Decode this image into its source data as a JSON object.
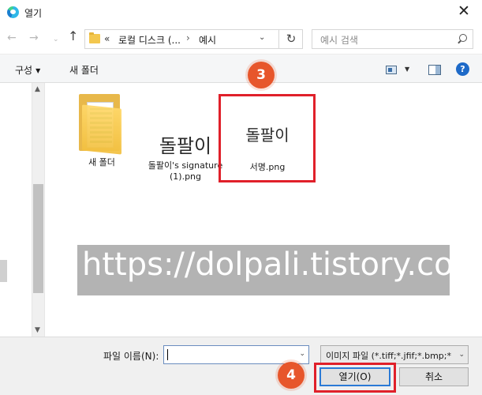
{
  "window": {
    "title": "열기",
    "close_glyph": "✕"
  },
  "nav": {
    "back": "←",
    "forward": "→",
    "recent": "⌄",
    "up": "↑",
    "breadcrumb": {
      "overflow": "«",
      "drive": "로컬 디스크 (...",
      "separator": "›",
      "folder": "예시"
    },
    "address_dropdown": "⌄",
    "refresh": "↻",
    "search_placeholder": "예시 검색"
  },
  "commandbar": {
    "organize": "구성",
    "organize_caret": "▼",
    "new_folder": "새 폴더",
    "view_caret": "▼",
    "help": "?"
  },
  "scrollbar": {
    "up": "▲",
    "down": "▼"
  },
  "files": [
    {
      "label": "새 폴더"
    },
    {
      "label": "돌팔이's signature (1).png",
      "thumb_text": "돌팔이"
    },
    {
      "label": "서명.png",
      "thumb_text": "돌팔이"
    }
  ],
  "annotations": {
    "step3": "3",
    "step4": "4",
    "watermark": "https://dolpali.tistory.com",
    "accent_color": "#e0202a"
  },
  "bottom": {
    "filename_label": "파일 이름(N):",
    "filename_value": "",
    "filename_dropdown": "⌄",
    "filetype_value": "이미지 파일 (*.tiff;*.jfif;*.bmp;*",
    "filetype_caret": "⌄",
    "open_button": "열기(O)",
    "cancel_button": "취소"
  }
}
